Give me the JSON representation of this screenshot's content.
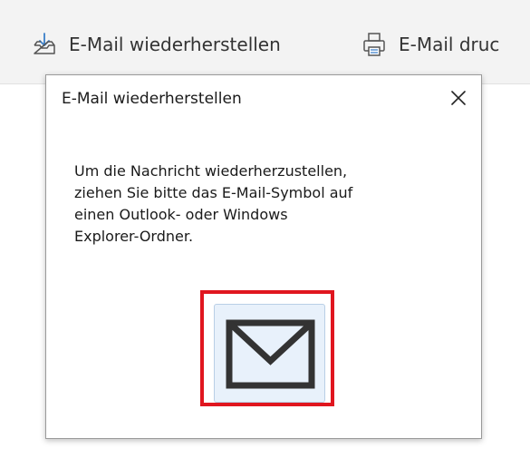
{
  "toolbar": {
    "restore_label": "E-Mail wiederherstellen",
    "restore_icon": "download-tray-icon",
    "print_label": "E-Mail druc",
    "print_icon": "printer-icon"
  },
  "dialog": {
    "title": "E-Mail wiederherstellen",
    "close_glyph": "✕",
    "message_lines": [
      "Um die Nachricht wiederherzustellen,",
      "ziehen Sie bitte das E-Mail-Symbol auf",
      "einen Outlook- oder Windows",
      "Explorer-Ordner."
    ],
    "mail_icon": "envelope-icon",
    "highlight_color": "#e0161f"
  }
}
